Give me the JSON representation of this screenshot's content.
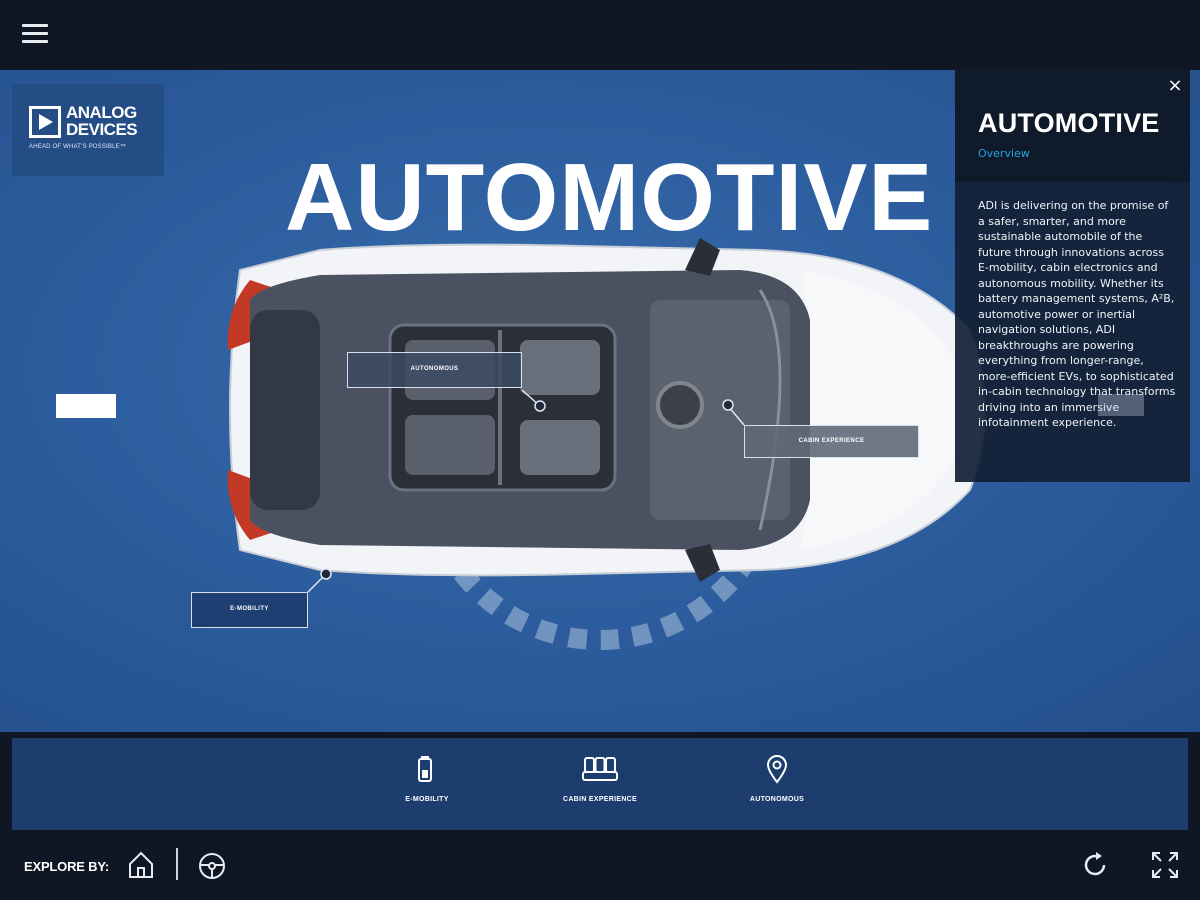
{
  "header": {
    "menu_icon": "hamburger-menu-icon"
  },
  "logo": {
    "line1": "ANALOG",
    "line2": "DEVICES",
    "tagline": "AHEAD OF WHAT'S POSSIBLE™"
  },
  "hero": {
    "title": "AUTOMOTIVE"
  },
  "hotspots": {
    "autonomous": "AUTONOMOUS",
    "cabin": "CABIN EXPERIENCE",
    "emobility": "E-MOBILITY"
  },
  "panel": {
    "close_label": "×",
    "title": "AUTOMOTIVE",
    "subtitle": "Overview",
    "body": "ADI is delivering on the promise of a safer, smarter, and more sustainable automobile of the future through innovations across E-mobility, cabin electronics and autonomous mobility. Whether its battery management systems, A²B, automotive power or inertial navigation solutions, ADI breakthroughs are powering everything from longer-range, more-efficient EVs, to sophisticated in-cabin technology that transforms driving into an immersive infotainment experience."
  },
  "bottom_nav": {
    "items": [
      {
        "label": "E-MOBILITY",
        "icon": "battery-icon"
      },
      {
        "label": "CABIN EXPERIENCE",
        "icon": "seats-icon"
      },
      {
        "label": "AUTONOMOUS",
        "icon": "location-pin-icon"
      }
    ]
  },
  "footer": {
    "explore_label": "EXPLORE BY:",
    "icons": [
      "home-icon",
      "steering-wheel-icon",
      "refresh-icon",
      "fullscreen-icon"
    ]
  },
  "colors": {
    "background": "#0f1624",
    "stage_blue": "#2d5e9f",
    "panel_accent": "#2aa1e0",
    "nav_blue": "#1d3d6f"
  }
}
